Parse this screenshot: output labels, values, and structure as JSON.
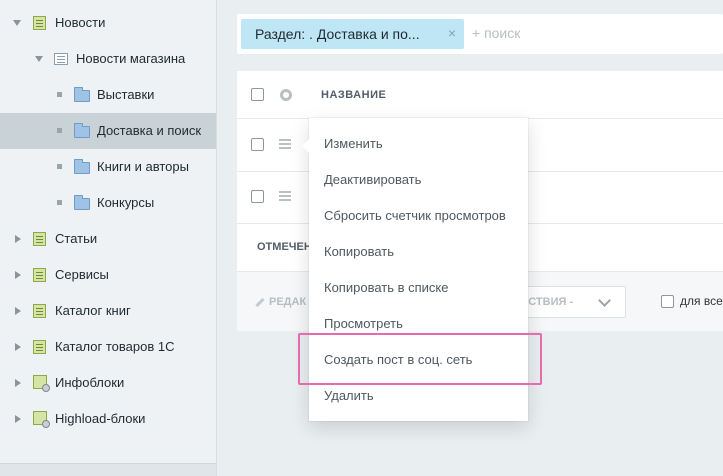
{
  "sidebar": {
    "items": [
      {
        "label": "Новости"
      },
      {
        "label": "Новости магазина"
      },
      {
        "label": "Выставки"
      },
      {
        "label": "Доставка и поиск"
      },
      {
        "label": "Книги и авторы"
      },
      {
        "label": "Конкурсы"
      },
      {
        "label": "Статьи"
      },
      {
        "label": "Сервисы"
      },
      {
        "label": "Каталог книг"
      },
      {
        "label": "Каталог товаров 1С"
      },
      {
        "label": "Инфоблоки"
      },
      {
        "label": "Highload-блоки"
      }
    ]
  },
  "filter": {
    "chip_label": "Раздел: . Доставка и по...",
    "chip_close": "×",
    "search_placeholder": "+ поиск"
  },
  "grid": {
    "column_title": "НАЗВАНИЕ",
    "selected_label": "ОТМЕЧЕН",
    "edit_label": "РЕДАК",
    "actions_label": "ЕЙСТВИЯ -",
    "for_all_label": "для все"
  },
  "context_menu": {
    "items": [
      {
        "label": "Изменить"
      },
      {
        "label": "Деактивировать"
      },
      {
        "label": "Сбросить счетчик просмотров"
      },
      {
        "label": "Копировать"
      },
      {
        "label": "Копировать в списке"
      },
      {
        "label": "Просмотреть"
      },
      {
        "label": "Создать пост в соц. сеть"
      },
      {
        "label": "Удалить"
      }
    ]
  },
  "colors": {
    "highlight": "#e56aae",
    "chip_bg": "#bfe6f5",
    "active_row": "#c9d3d7"
  }
}
